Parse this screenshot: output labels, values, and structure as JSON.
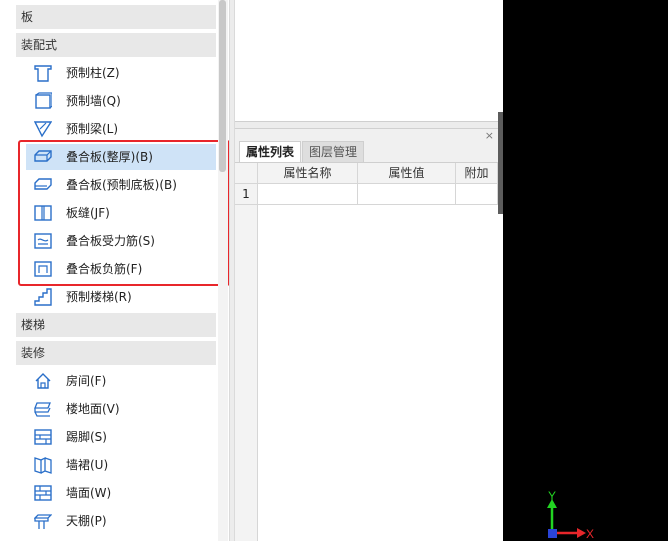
{
  "tree": {
    "groups": [
      "板",
      "装配式",
      "楼梯",
      "装修"
    ],
    "prefab_items": [
      {
        "label": "预制柱(Z)",
        "icon": "prefab-column-icon"
      },
      {
        "label": "预制墙(Q)",
        "icon": "prefab-wall-icon"
      },
      {
        "label": "预制梁(L)",
        "icon": "prefab-beam-icon"
      },
      {
        "label": "叠合板(整厚)(B)",
        "icon": "composite-slab-full-icon"
      },
      {
        "label": "叠合板(预制底板)(B)",
        "icon": "composite-slab-precast-icon"
      },
      {
        "label": "板缝(JF)",
        "icon": "slab-joint-icon"
      },
      {
        "label": "叠合板受力筋(S)",
        "icon": "slab-rebar-icon"
      },
      {
        "label": "叠合板负筋(F)",
        "icon": "slab-negative-rebar-icon"
      },
      {
        "label": "预制楼梯(R)",
        "icon": "prefab-stair-icon"
      }
    ],
    "decor_items": [
      {
        "label": "房间(F)",
        "icon": "room-icon"
      },
      {
        "label": "楼地面(V)",
        "icon": "floor-icon"
      },
      {
        "label": "踢脚(S)",
        "icon": "skirting-icon"
      },
      {
        "label": "墙裙(U)",
        "icon": "dado-icon"
      },
      {
        "label": "墙面(W)",
        "icon": "wall-surface-icon"
      },
      {
        "label": "天棚(P)",
        "icon": "ceiling-icon"
      }
    ]
  },
  "properties": {
    "close_glyph": "×",
    "tabs": [
      "属性列表",
      "图层管理"
    ],
    "columns": [
      "属性名称",
      "属性值",
      "附加"
    ],
    "rows": [
      [
        "1",
        "",
        "",
        ""
      ]
    ]
  },
  "canvas": {
    "axis_y": "Y",
    "axis_x": "X"
  },
  "colors": {
    "accent": "#2a6fc9",
    "highlight": "#e8262b",
    "selected": "#cfe3f7"
  }
}
